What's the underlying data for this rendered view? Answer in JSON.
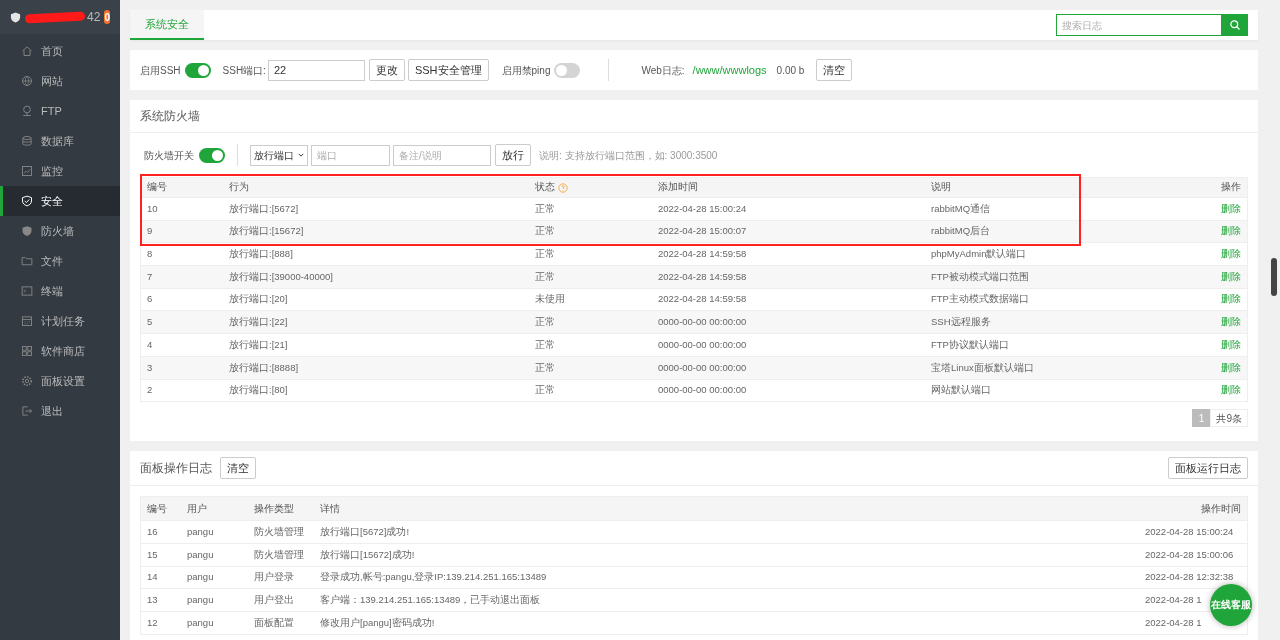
{
  "sidebar": {
    "title": "42",
    "badge": "0",
    "items": [
      {
        "label": "首页",
        "selected": false
      },
      {
        "label": "网站",
        "selected": false
      },
      {
        "label": "FTP",
        "selected": false
      },
      {
        "label": "数据库",
        "selected": false
      },
      {
        "label": "监控",
        "selected": false
      },
      {
        "label": "安全",
        "selected": true
      },
      {
        "label": "防火墙",
        "selected": false
      },
      {
        "label": "文件",
        "selected": false
      },
      {
        "label": "终端",
        "selected": false
      },
      {
        "label": "计划任务",
        "selected": false
      },
      {
        "label": "软件商店",
        "selected": false
      },
      {
        "label": "面板设置",
        "selected": false
      },
      {
        "label": "退出",
        "selected": false
      }
    ]
  },
  "tabs": [
    {
      "label": "系统安全",
      "selected": true
    }
  ],
  "search": {
    "placeholder": "搜索日志"
  },
  "ssh_bar": {
    "ssh_label": "启用SSH",
    "ssh_on": true,
    "port_label": "SSH端口:",
    "port_value": "22",
    "change_button": "更改",
    "manage_button": "SSH安全管理",
    "ping_label": "启用禁ping",
    "ping_on": false,
    "weblog_label": "Web日志:",
    "weblog_path": "/www/wwwlogs",
    "weblog_size": "0.00 b",
    "clear_button": "清空"
  },
  "firewall": {
    "title": "系统防火墙",
    "switch_label": "防火墙开关",
    "switch_on": true,
    "select_value": "放行端口",
    "port_placeholder": "端口",
    "note_placeholder": "备注/说明",
    "allow_button": "放行",
    "hint": "说明: 支持放行端口范围，如: 3000:3500",
    "columns": [
      "编号",
      "行为",
      "状态",
      "添加时间",
      "说明",
      "操作"
    ],
    "rows": [
      {
        "id": "10",
        "action": "放行端口:[5672]",
        "status": "正常",
        "time": "2022-04-28 15:00:24",
        "note": "rabbitMQ通信",
        "op": "删除",
        "highlighted": true
      },
      {
        "id": "9",
        "action": "放行端口:[15672]",
        "status": "正常",
        "time": "2022-04-28 15:00:07",
        "note": "rabbitMQ后台",
        "op": "删除",
        "highlighted": true
      },
      {
        "id": "8",
        "action": "放行端口:[888]",
        "status": "正常",
        "time": "2022-04-28 14:59:58",
        "note": "phpMyAdmin默认端口",
        "op": "删除",
        "highlighted": false
      },
      {
        "id": "7",
        "action": "放行端口:[39000-40000]",
        "status": "正常",
        "time": "2022-04-28 14:59:58",
        "note": "FTP被动模式端口范围",
        "op": "删除",
        "highlighted": false
      },
      {
        "id": "6",
        "action": "放行端口:[20]",
        "status": "未使用",
        "time": "2022-04-28 14:59:58",
        "note": "FTP主动模式数据端口",
        "op": "删除",
        "highlighted": false
      },
      {
        "id": "5",
        "action": "放行端口:[22]",
        "status": "正常",
        "time": "0000-00-00 00:00:00",
        "note": "SSH远程服务",
        "op": "删除",
        "highlighted": false
      },
      {
        "id": "4",
        "action": "放行端口:[21]",
        "status": "正常",
        "time": "0000-00-00 00:00:00",
        "note": "FTP协议默认端口",
        "op": "删除",
        "highlighted": false
      },
      {
        "id": "3",
        "action": "放行端口:[8888]",
        "status": "正常",
        "time": "0000-00-00 00:00:00",
        "note": "宝塔Linux面板默认端口",
        "op": "删除",
        "highlighted": false
      },
      {
        "id": "2",
        "action": "放行端口:[80]",
        "status": "正常",
        "time": "0000-00-00 00:00:00",
        "note": "网站默认端口",
        "op": "删除",
        "highlighted": false
      }
    ],
    "pagination": {
      "pages": [
        {
          "label": "1",
          "selected": true
        }
      ],
      "total": "共9条"
    }
  },
  "log": {
    "title": "面板操作日志",
    "clear_button": "清空",
    "run_log_button": "面板运行日志",
    "columns": [
      "编号",
      "用户",
      "操作类型",
      "详情",
      "操作时间"
    ],
    "rows": [
      {
        "id": "16",
        "user": "pangu",
        "type": "防火墙管理",
        "detail": "放行端口[5672]成功!",
        "time": "2022-04-28 15:00:24"
      },
      {
        "id": "15",
        "user": "pangu",
        "type": "防火墙管理",
        "detail": "放行端口[15672]成功!",
        "time": "2022-04-28 15:00:06"
      },
      {
        "id": "14",
        "user": "pangu",
        "type": "用户登录",
        "detail": "登录成功,帐号:pangu,登录IP:139.214.251.165:13489",
        "time": "2022-04-28 12:32:38"
      },
      {
        "id": "13",
        "user": "pangu",
        "type": "用户登出",
        "detail": "客户端：139.214.251.165:13489，已手动退出面板",
        "time": "2022-04-28 1"
      },
      {
        "id": "12",
        "user": "pangu",
        "type": "面板配置",
        "detail": "修改用户[pangu]密码成功!",
        "time": "2022-04-28 1"
      }
    ]
  },
  "chat_button": "在线客服"
}
